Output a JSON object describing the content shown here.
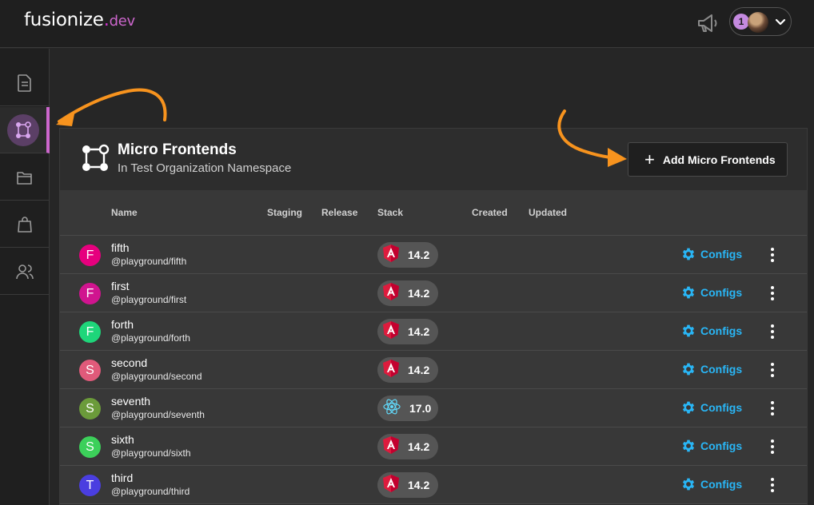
{
  "app": {
    "logo_main": "fusionize",
    "logo_dot": ".",
    "logo_suffix": "dev",
    "notification_count": "1"
  },
  "sidebar": {
    "items": [
      {
        "icon": "document-icon"
      },
      {
        "icon": "micro-frontends-icon",
        "active": true
      },
      {
        "icon": "folder-icon"
      },
      {
        "icon": "bag-icon"
      },
      {
        "icon": "users-icon"
      }
    ]
  },
  "panel": {
    "title": "Micro Frontends",
    "subtitle": "In Test Organization Namespace",
    "add_button_label": "Add Micro Frontends"
  },
  "table": {
    "headers": {
      "name": "Name",
      "staging": "Staging",
      "release": "Release",
      "stack": "Stack",
      "created": "Created",
      "updated": "Updated"
    },
    "configs_label": "Configs",
    "rows": [
      {
        "initial": "F",
        "color": "#e6007e",
        "name": "fifth",
        "package": "@playground/fifth",
        "stack": "angular",
        "version": "14.2"
      },
      {
        "initial": "F",
        "color": "#d0148f",
        "name": "first",
        "package": "@playground/first",
        "stack": "angular",
        "version": "14.2"
      },
      {
        "initial": "F",
        "color": "#1ed67a",
        "name": "forth",
        "package": "@playground/forth",
        "stack": "angular",
        "version": "14.2"
      },
      {
        "initial": "S",
        "color": "#e05a7a",
        "name": "second",
        "package": "@playground/second",
        "stack": "angular",
        "version": "14.2"
      },
      {
        "initial": "S",
        "color": "#6b9b3a",
        "name": "seventh",
        "package": "@playground/seventh",
        "stack": "react",
        "version": "17.0"
      },
      {
        "initial": "S",
        "color": "#3cd05a",
        "name": "sixth",
        "package": "@playground/sixth",
        "stack": "angular",
        "version": "14.2"
      },
      {
        "initial": "T",
        "color": "#4a3ee0",
        "name": "third",
        "package": "@playground/third",
        "stack": "angular",
        "version": "14.2"
      }
    ]
  },
  "colors": {
    "accent": "#cc66cc",
    "configs": "#29b6f6",
    "annotation_arrow": "#f7931e"
  }
}
